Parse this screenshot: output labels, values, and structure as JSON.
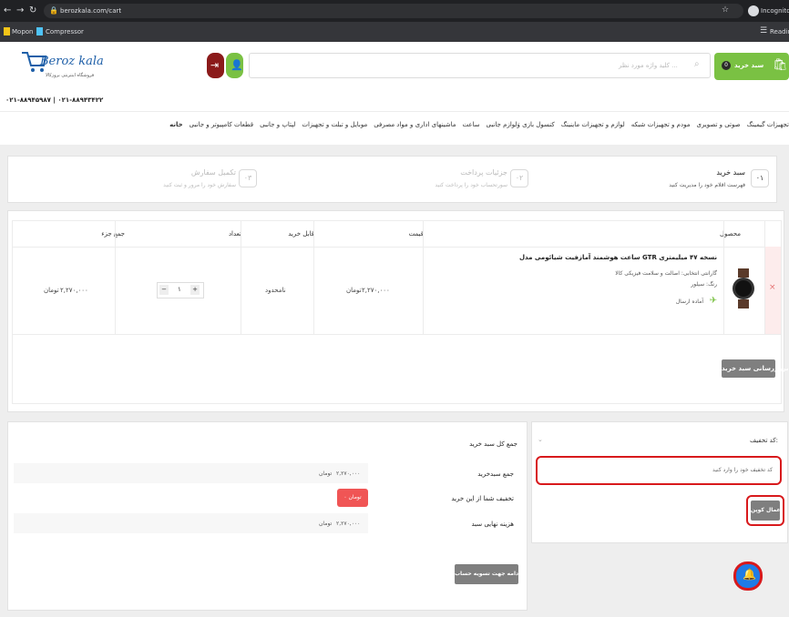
{
  "browser": {
    "url": "berozkala.com/cart",
    "incognito_label": "Incognito",
    "bookmarks": [
      "Mopon",
      "Compressor"
    ],
    "reading_list": "Reading"
  },
  "header": {
    "logo_text": "Beroz kala",
    "logo_subtitle": "فروشگاه اینترنتی بروزکالا",
    "phone": "۰۲۱-۸۸۹۴۵۹۸۷ | ۰۲۱-۸۸۹۴۳۴۲۲",
    "cart_button_label": "سبد خرید",
    "cart_count": "0",
    "search_placeholder": "کلید واژه مورد نظر ..."
  },
  "categories": [
    "خانه",
    "قطعات کامپیوتر و جانبی",
    "لپتاپ و جانبی",
    "موبایل و تبلت و تجهیزات",
    "ماشینهای اداری و مواد مصرفی",
    "ساعت",
    "کنسول بازی وَلوازم جانبی",
    "لوازم و تجهیزات ماینینگ",
    "مودم و تجهیزات شبکه",
    "صوتی و تصویری",
    "تجهیزات گیمینگ"
  ],
  "steps": [
    {
      "num": "۰۱",
      "title": "سبد خرید",
      "desc": "فهرست اقلام خود را مدیریت کنید"
    },
    {
      "num": "۰۲",
      "title": "جزئیات پرداخت",
      "desc": "سورتحساب خود را پرداخت کنید"
    },
    {
      "num": "۰۳",
      "title": "تکمیل سفارش",
      "desc": "سفارش خود را مرور و ثبت کنید"
    }
  ],
  "table": {
    "headers": {
      "product": "محصول",
      "price": "قیمت",
      "available": "قابل خرید",
      "qty": "تعداد",
      "subtotal": "جمع جزء"
    },
    "row": {
      "remove": "×",
      "name": "ساعت هوشمند آمازفیت شیائومی مدل GTR نسخه ۴۷ میلیمتری",
      "guarantee": "گارانتی انتخابی: اصالت و سلامت فیزیکی کالا",
      "color": "رنگ: سیلور",
      "status": "آماده ارسال",
      "price": "۲,۲۷۰,۰۰۰",
      "price_unit": "تومان",
      "available": "نامحدود",
      "qty": "۱",
      "subtotal": "۲,۲۷۰,۰۰۰",
      "subtotal_unit": "تومان"
    },
    "update_button": "بروزرسانی سبد خرید"
  },
  "coupon": {
    "title": "کد تخفیف:",
    "placeholder": "کد تخفیف خود را وارد کنید",
    "apply_button": "اعمال کوپن"
  },
  "totals": {
    "title": "جمع کل سبد خرید",
    "rows": [
      {
        "label": "جمع سبدخرید",
        "value": "۲,۲۷۰,۰۰۰",
        "unit": "تومان"
      },
      {
        "label": "تخفیف شما از این خرید",
        "value": "۰ تومان"
      },
      {
        "label": "هزینه نهایی سبد",
        "value": "۲,۲۷۰,۰۰۰",
        "unit": "تومان"
      }
    ],
    "checkout_button": "ادامه جهت تسویه حساب"
  },
  "colors": {
    "green": "#7ac143",
    "red": "#d8191c",
    "dark_red": "#8b1a1a",
    "blue": "#1e7be6"
  }
}
